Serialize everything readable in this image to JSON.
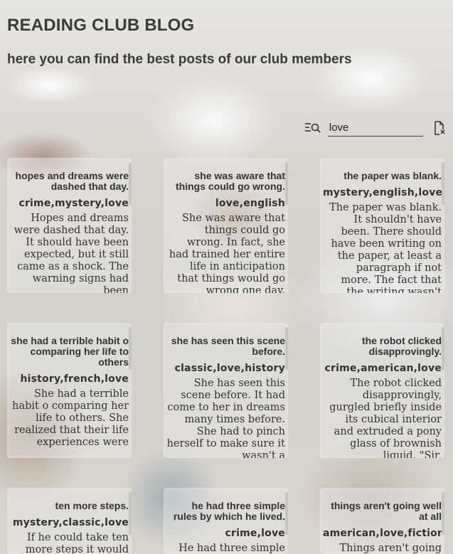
{
  "header": {
    "title": "READING CLUB BLOG",
    "subtitle": "here you can find the best posts of our club members"
  },
  "search": {
    "value": "love",
    "placeholder": ""
  },
  "icons": {
    "search": "search-list-icon",
    "clear": "clear-file-icon"
  },
  "posts": [
    {
      "title": "hopes and dreams were dashed that day.",
      "tags": "crime,mystery,love",
      "body": "Hopes and dreams were dashed that day. It should have been expected, but it still came as a shock. The warning signs had been"
    },
    {
      "title": "she was aware that things could go wrong.",
      "tags": "love,english",
      "body": "She was aware that things could go wrong. In fact, she had trained her entire life in anticipation that things would go wrong one day."
    },
    {
      "title": "the paper was blank.",
      "tags": "mystery,english,love",
      "body": "The paper was blank. It shouldn't have been. There should have been writing on the paper, at least a paragraph if not more. The fact that the writing wasn't there"
    },
    {
      "title": "she had a terrible habit o comparing her life to others",
      "tags": "history,french,love",
      "body": "She had a terrible habit o comparing her life to others. She realized that their life experiences were"
    },
    {
      "title": "she has seen this scene before.",
      "tags": "classic,love,history",
      "body": "She has seen this scene before. It had come to her in dreams many times before. She had to pinch herself to make sure it wasn't a"
    },
    {
      "title": "the robot clicked disapprovingly.",
      "tags": "crime,american,love",
      "body": "The robot clicked disapprovingly, gurgled briefly inside its cubical interior and extruded a pony glass of brownish liquid. \"Sir,"
    },
    {
      "title": "ten more steps.",
      "tags": "mystery,classic,love",
      "body": "If he could take ten more steps it would be"
    },
    {
      "title": "he had three simple rules by which he lived.",
      "tags": "crime,love",
      "body": "He had three simple rules by which he lived."
    },
    {
      "title": "things aren't going well at all",
      "tags": "american,love,fiction",
      "body": "Things aren't going well at all with mom today."
    }
  ]
}
